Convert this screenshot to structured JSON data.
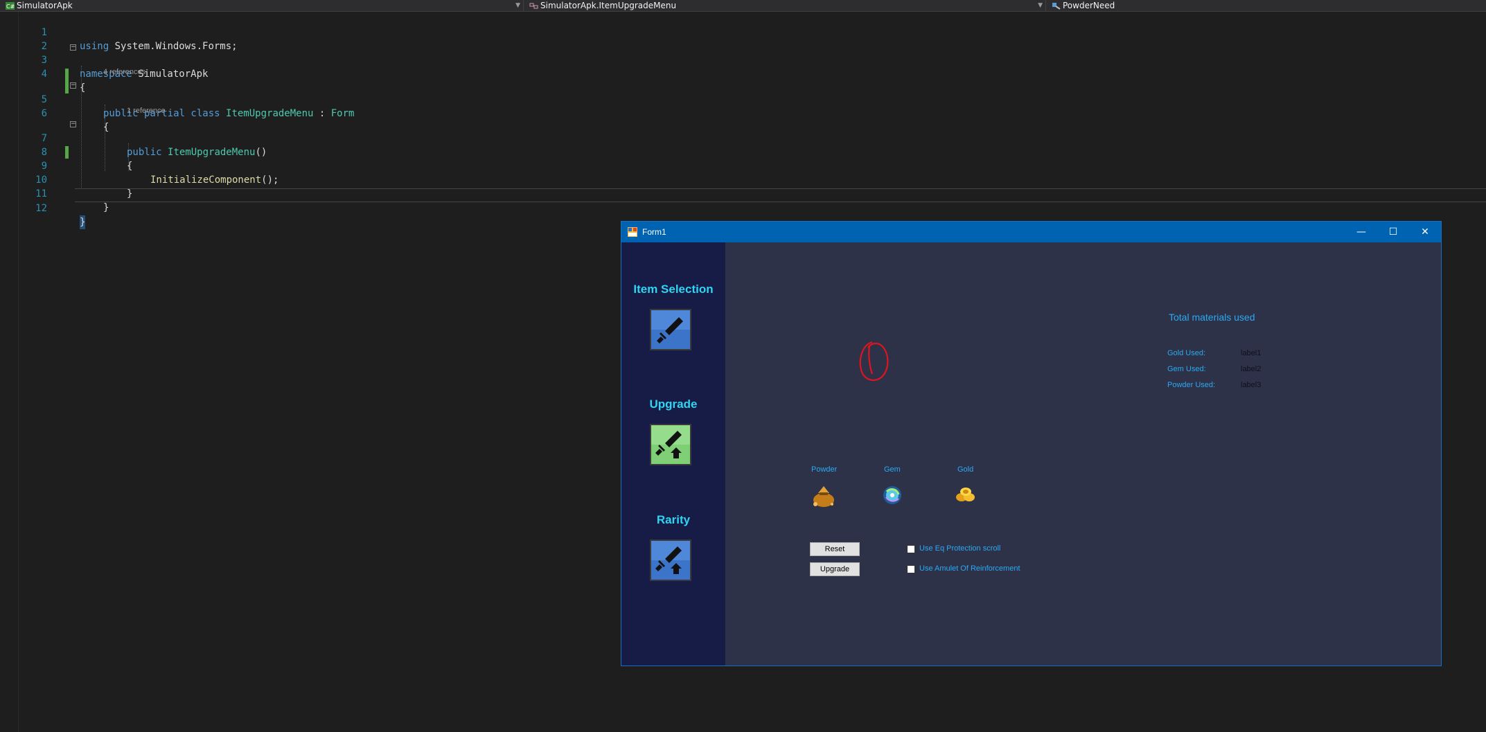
{
  "ide": {
    "nav_project": "SimulatorApk",
    "nav_class": "SimulatorApk.ItemUpgradeMenu",
    "nav_member": "PowderNeed",
    "code": {
      "line_numbers": [
        "1",
        "2",
        "3",
        "4",
        "5",
        "6",
        "7",
        "8",
        "9",
        "10",
        "11",
        "12"
      ],
      "l1": {
        "kw": "using",
        "rest": " System.Windows.Forms;"
      },
      "l3": {
        "kw": "namespace",
        "rest": " SimulatorApk"
      },
      "l4": "{",
      "lens_class": "4 references",
      "l5": {
        "kw": "public partial class",
        "ty": "ItemUpgradeMenu",
        "mid": " : ",
        "base": "Form"
      },
      "l6": "{",
      "lens_ctor": "1 reference",
      "l7": {
        "kw": "public",
        "ty": "ItemUpgradeMenu",
        "rest": "()"
      },
      "l8": "{",
      "l9": {
        "fn": "InitializeComponent",
        "rest": "();"
      },
      "l10": "}",
      "l11": "}",
      "l12": "}"
    }
  },
  "form": {
    "title": "Form1",
    "minimize": "—",
    "maximize": "☐",
    "close": "✕",
    "sidebar": {
      "item_selection": "Item Selection",
      "upgrade": "Upgrade",
      "rarity": "Rarity"
    },
    "materials": {
      "powder": "Powder",
      "gem": "Gem",
      "gold": "Gold"
    },
    "summary": {
      "title": "Total materials used",
      "gold_label": "Gold Used:",
      "gold_value": "label1",
      "gem_label": "Gem Used:",
      "gem_value": "label2",
      "powder_label": "Powder Used:",
      "powder_value": "label3"
    },
    "buttons": {
      "reset": "Reset",
      "upgrade": "Upgrade"
    },
    "options": {
      "protection_scroll": "Use Eq Protection scroll",
      "amulet": "Use Amulet Of Reinforcement"
    },
    "colors": {
      "sidebar": "#161c46",
      "panel": "#2e3248",
      "accent": "#2fd5f2",
      "label": "#29aaf4",
      "titlebar": "#0063b1"
    }
  }
}
